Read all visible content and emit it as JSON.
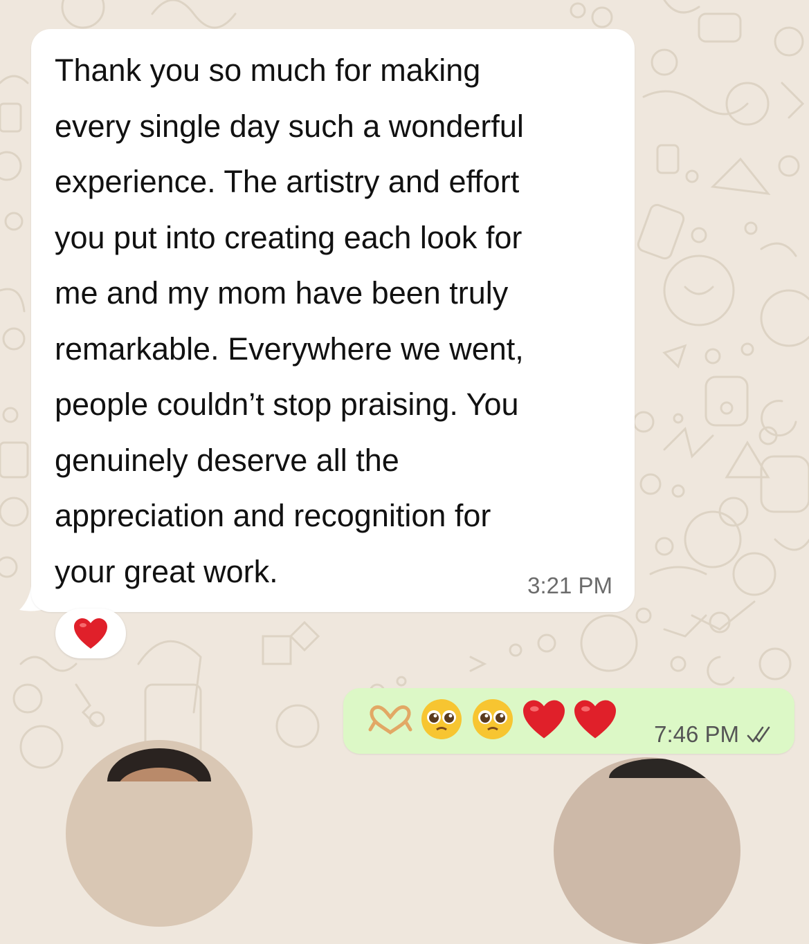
{
  "chat": {
    "incoming_message": {
      "text": "Thank you so much for making\nevery single day such a wonderful\nexperience. The artistry and effort\nyou put into creating each look for\nme and my mom have been truly\nremarkable. Everywhere we went,\npeople couldn’t stop praising. You\ngenuinely deserve all the\nappreciation and recognition for\nyour great work.",
      "time": "3:21 PM",
      "reaction": "heart-emoji",
      "bubble_color": "#ffffff"
    },
    "outgoing_message": {
      "emojis": [
        "heart-hands-emoji",
        "pleading-face-emoji",
        "pleading-face-emoji",
        "red-heart-emoji",
        "red-heart-emoji"
      ],
      "time": "7:46 PM",
      "status": "read-double-check-icon",
      "bubble_color": "#dcf8c6"
    },
    "wallpaper_color": "#efe7dd"
  }
}
